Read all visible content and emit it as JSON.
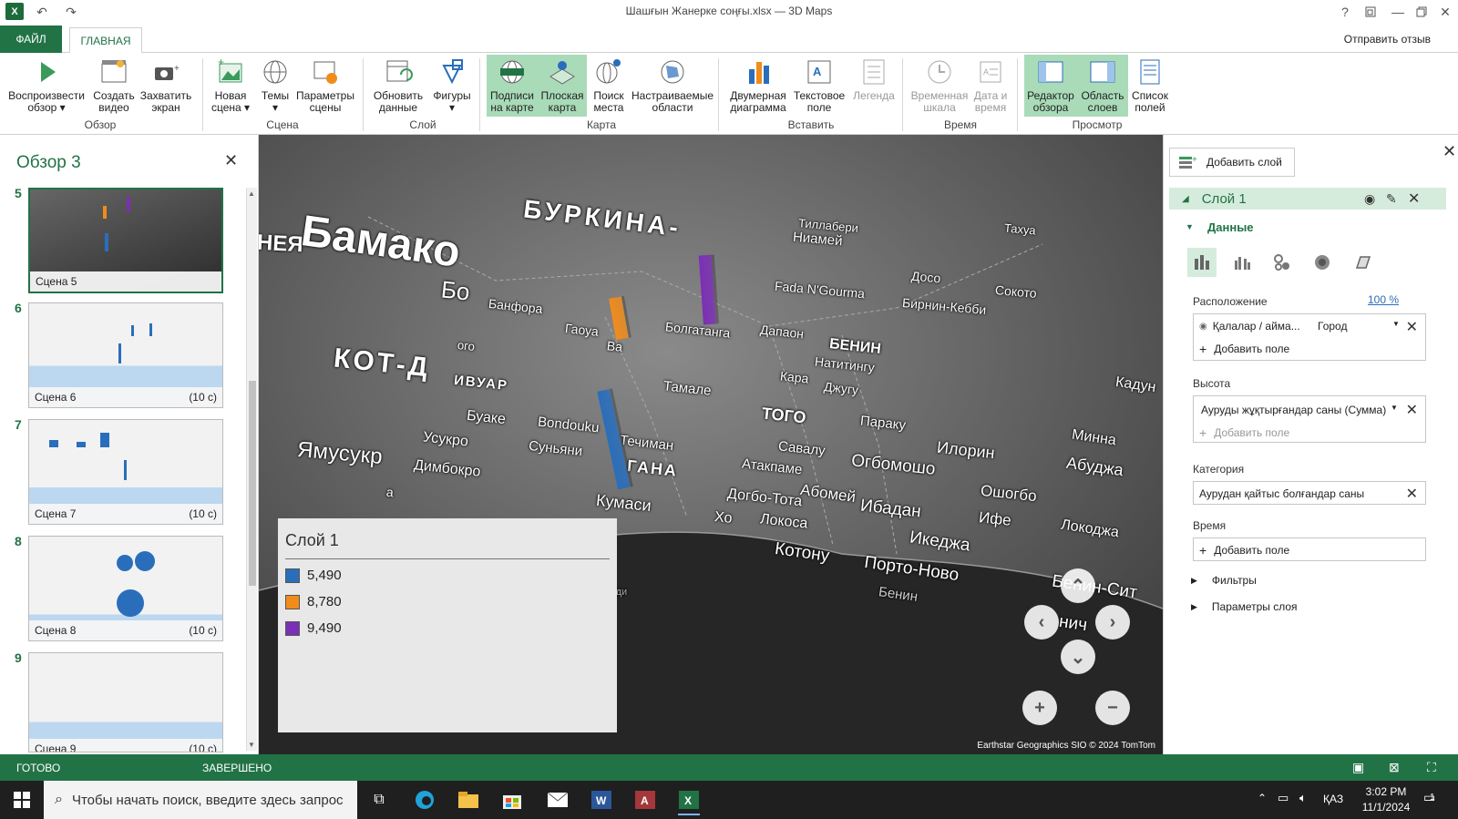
{
  "window": {
    "title": "Шашғын Жанерке соңғы.xlsx — 3D Maps",
    "help": "?",
    "minimize": "—",
    "close": "✕"
  },
  "tabs": {
    "file": "ФАЙЛ",
    "home": "ГЛАВНАЯ",
    "feedback": "Отправить отзыв"
  },
  "ribbon": {
    "play_tour": [
      "Воспроизвести",
      "обзор ▾"
    ],
    "create_video": [
      "Создать",
      "видео"
    ],
    "capture_screen": [
      "Захватить",
      "экран"
    ],
    "group_tour": "Обзор",
    "new_scene": [
      "Новая",
      "сцена ▾"
    ],
    "themes": [
      "Темы",
      "▾"
    ],
    "scene_options": [
      "Параметры",
      "сцены"
    ],
    "group_scene": "Сцена",
    "refresh_data": [
      "Обновить",
      "данные"
    ],
    "shapes": [
      "Фигуры",
      "▾"
    ],
    "group_layer": "Слой",
    "map_labels": [
      "Подписи",
      "на карте"
    ],
    "flat_map": [
      "Плоская",
      "карта"
    ],
    "find_location": [
      "Поиск",
      "места"
    ],
    "custom_regions": [
      "Настраиваемые",
      "области"
    ],
    "group_map": "Карта",
    "chart_2d": [
      "Двумерная",
      "диаграмма"
    ],
    "text_box": [
      "Текстовое",
      "поле"
    ],
    "legend": [
      "Легенда",
      ""
    ],
    "group_insert": "Вставить",
    "timeline": [
      "Временная",
      "шкала"
    ],
    "date_time": [
      "Дата и",
      "время"
    ],
    "group_time": "Время",
    "tour_editor": [
      "Редактор",
      "обзора"
    ],
    "layer_pane": [
      "Область",
      "слоев"
    ],
    "field_list": [
      "Список",
      "полей"
    ],
    "group_view": "Просмотр"
  },
  "tour": {
    "title": "Обзор 3",
    "scenes": [
      {
        "num": "5",
        "label": "Сцена 5",
        "duration": ""
      },
      {
        "num": "6",
        "label": "Сцена 6",
        "duration": "(10 с)"
      },
      {
        "num": "7",
        "label": "Сцена 7",
        "duration": "(10 с)"
      },
      {
        "num": "8",
        "label": "Сцена 8",
        "duration": "(10 с)"
      },
      {
        "num": "9",
        "label": "Сцена 9",
        "duration": "(10 с)"
      }
    ]
  },
  "map": {
    "labels": {
      "bamako": "Бамако",
      "neya": "НЕЯ",
      "burkina": "БУРКИНА-",
      "tillaberi": "Тиллабери",
      "niamey": "Ниамей",
      "dosso": "Досо",
      "sokoto": "Сокото",
      "birnin_kebbi": "Бирнин-Кебби",
      "takhua": "Тахуа",
      "fada": "Fada N'Gourma",
      "bo": "Бо",
      "banfora": "Банфора",
      "gaoua": "Гаоуа",
      "va": "Ва",
      "bolgatanga": "Болгатанга",
      "dapaon": "Дапаон",
      "benin": "БЕНИН",
      "natitingu": "Натитингу",
      "kara": "Кара",
      "djugu": "Джугу",
      "tamale": "Тамале",
      "kadun": "Кадун",
      "kot": "КОТ-Д",
      "ivuar": "ИВУАР",
      "bouake": "Буаке",
      "bondouku": "Bondouku",
      "techiman": "Течиман",
      "togo": "ТОГО",
      "paraku": "Параку",
      "minna": "Минна",
      "usukro": "Усукро",
      "sunyani": "Суньяни",
      "savalu": "Савалу",
      "ilorin": "Илорин",
      "abuja": "Абуджа",
      "yamusukr": "Ямусукр",
      "dimbokro": "Димбокро",
      "gana": "ГАНА",
      "atakpame": "Атакпаме",
      "ogbomosho": "Огбомошо",
      "kumasi": "Кумаси",
      "abomey": "Абомей",
      "ibadan": "Ибадан",
      "oshogbo": "Ошогбо",
      "dogbo": "Догбо-Тота",
      "ho": "Хо",
      "lokosa": "Локоса",
      "ife": "Ифе",
      "lokodzha": "Локоджа",
      "ikedzha": "Икеджа",
      "kotonu": "Котону",
      "porto_novo": "Порто-Ново",
      "benin_city": "Бенин",
      "benin_sit": "Бенин-Сит",
      "nich": "нич",
      "a": "а",
      "ogo": "ого",
      "takoradi": "Такоради"
    },
    "attribution": "Earthstar Geographics  SIO  © 2024 TomTom"
  },
  "legend": {
    "title": "Слой 1",
    "items": [
      {
        "label": "5,490",
        "color": "#2a6ebb"
      },
      {
        "label": "8,780",
        "color": "#f08c1c"
      },
      {
        "label": "9,490",
        "color": "#7b2fb5"
      }
    ]
  },
  "layer_panel": {
    "add_layer": "Добавить слой",
    "layer_name": "Слой 1",
    "data_section": "Данные",
    "location_label": "Расположение",
    "location_percent": "100 %",
    "location_field": "Қалалар / аймa...",
    "location_type": "Город",
    "add_field": "Добавить поле",
    "height_label": "Высота",
    "height_field": "Ауруды жұқтырғандар саны (Сумма)",
    "category_label": "Категория",
    "category_field": "Аурудан қайтыс болғандар саны",
    "time_label": "Время",
    "filters": "Фильтры",
    "layer_options": "Параметры слоя"
  },
  "status": {
    "ready": "ГОТОВО",
    "completed": "ЗАВЕРШЕНО"
  },
  "taskbar": {
    "search_placeholder": "Чтобы начать поиск, введите здесь запрос",
    "lang": "ҚАЗ",
    "time": "3:02 PM",
    "date": "11/1/2024",
    "notifications": "1"
  },
  "colors": {
    "accent": "#217346",
    "active_ribbon": "#a9dbb8",
    "layer_row": "#d5ecdc"
  }
}
